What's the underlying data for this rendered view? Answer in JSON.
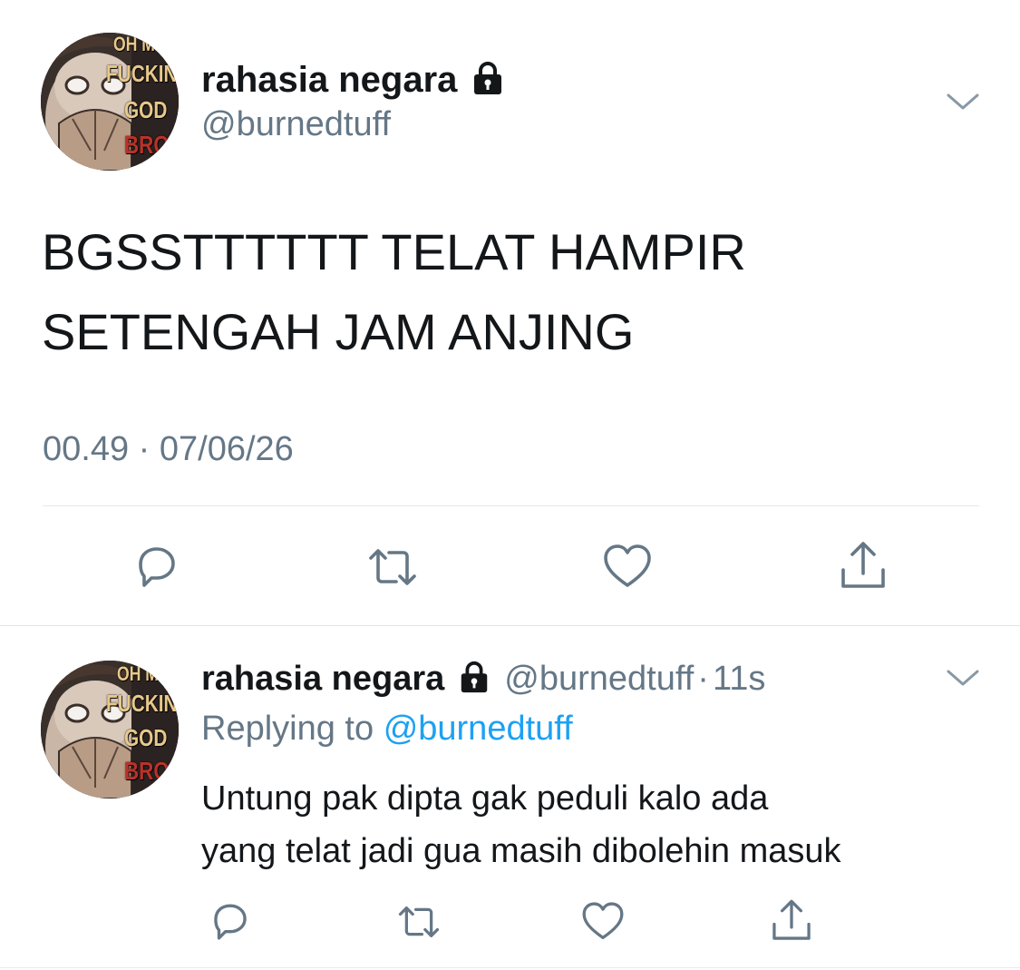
{
  "tweet": {
    "display_name": "rahasia negara",
    "handle": "@burnedtuff",
    "text_line1": "BGSSTTTTTT TELAT HAMPIR",
    "text_line2": "SETENGAH JAM ANJING",
    "time": "00.49",
    "separator": "·",
    "date": "07/06/26",
    "avatar_caption": [
      "OH M",
      "FUCKING",
      "GOD",
      "BRO"
    ],
    "actions": [
      "reply-icon",
      "retweet-icon",
      "like-icon",
      "share-icon"
    ]
  },
  "reply": {
    "display_name": "rahasia negara",
    "handle": "@burnedtuff",
    "separator": "·",
    "age": "11s",
    "replying_label": "Replying to",
    "replying_handle": "@burnedtuff",
    "text_line1": "Untung pak dipta gak peduli kalo ada",
    "text_line2": "yang telat jadi gua masih dibolehin masuk",
    "avatar_caption": [
      "OH M",
      "FUCKING",
      "GOD",
      "BRO"
    ],
    "actions": [
      "reply-icon",
      "retweet-icon",
      "like-icon",
      "share-icon"
    ]
  },
  "colors": {
    "text": "#14171a",
    "secondary": "#657786",
    "link": "#1da1f2",
    "divider": "#e1e8ed"
  }
}
